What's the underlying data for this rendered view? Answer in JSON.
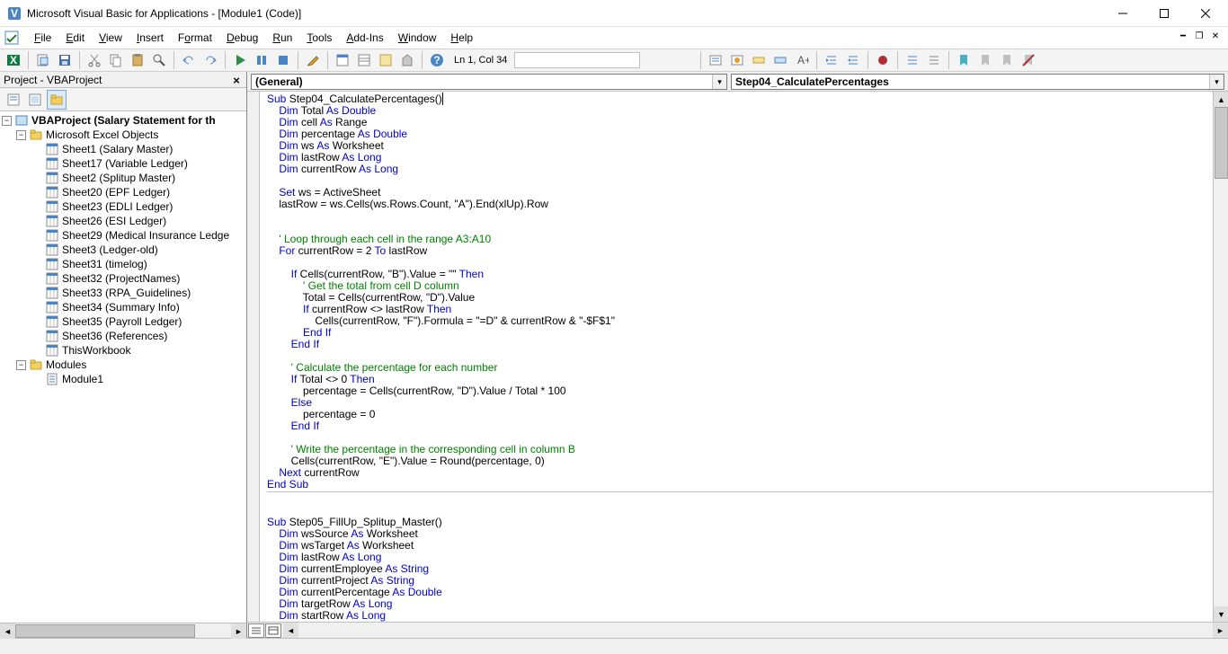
{
  "title": "Microsoft Visual Basic for Applications - [Module1 (Code)]",
  "menus": [
    "File",
    "Edit",
    "View",
    "Insert",
    "Format",
    "Debug",
    "Run",
    "Tools",
    "Add-Ins",
    "Window",
    "Help"
  ],
  "menu_underlines": [
    "F",
    "E",
    "V",
    "I",
    "o",
    "D",
    "R",
    "T",
    "A",
    "W",
    "H"
  ],
  "cursor_pos": "Ln 1, Col 34",
  "project_title": "Project - VBAProject",
  "combo_left": "(General)",
  "combo_right": "Step04_CalculatePercentages",
  "tree": {
    "root": "VBAProject (Salary Statement for th",
    "folder1": "Microsoft Excel Objects",
    "sheets": [
      "Sheet1 (Salary Master)",
      "Sheet17 (Variable Ledger)",
      "Sheet2 (Splitup Master)",
      "Sheet20 (EPF Ledger)",
      "Sheet23 (EDLI Ledger)",
      "Sheet26 (ESI Ledger)",
      "Sheet29 (Medical Insurance Ledge",
      "Sheet3 (Ledger-old)",
      "Sheet31 (timelog)",
      "Sheet32 (ProjectNames)",
      "Sheet33 (RPA_Guidelines)",
      "Sheet34 (Summary Info)",
      "Sheet35 (Payroll Ledger)",
      "Sheet36 (References)",
      "ThisWorkbook"
    ],
    "folder2": "Modules",
    "modules": [
      "Module1"
    ]
  },
  "code_lines": [
    [
      [
        "kw",
        "Sub"
      ],
      [
        "tx",
        " Step04_CalculatePercentages()"
      ],
      [
        "cursor",
        ""
      ]
    ],
    [
      [
        "tx",
        "    "
      ],
      [
        "kw",
        "Dim"
      ],
      [
        "tx",
        " Total "
      ],
      [
        "kw",
        "As Double"
      ]
    ],
    [
      [
        "tx",
        "    "
      ],
      [
        "kw",
        "Dim"
      ],
      [
        "tx",
        " cell "
      ],
      [
        "kw",
        "As"
      ],
      [
        "tx",
        " Range"
      ]
    ],
    [
      [
        "tx",
        "    "
      ],
      [
        "kw",
        "Dim"
      ],
      [
        "tx",
        " percentage "
      ],
      [
        "kw",
        "As Double"
      ]
    ],
    [
      [
        "tx",
        "    "
      ],
      [
        "kw",
        "Dim"
      ],
      [
        "tx",
        " ws "
      ],
      [
        "kw",
        "As"
      ],
      [
        "tx",
        " Worksheet"
      ]
    ],
    [
      [
        "tx",
        "    "
      ],
      [
        "kw",
        "Dim"
      ],
      [
        "tx",
        " lastRow "
      ],
      [
        "kw",
        "As Long"
      ]
    ],
    [
      [
        "tx",
        "    "
      ],
      [
        "kw",
        "Dim"
      ],
      [
        "tx",
        " currentRow "
      ],
      [
        "kw",
        "As Long"
      ]
    ],
    [
      [
        "tx",
        ""
      ]
    ],
    [
      [
        "tx",
        "    "
      ],
      [
        "kw",
        "Set"
      ],
      [
        "tx",
        " ws = ActiveSheet"
      ]
    ],
    [
      [
        "tx",
        "    lastRow = ws.Cells(ws.Rows.Count, \"A\").End(xlUp).Row"
      ]
    ],
    [
      [
        "tx",
        ""
      ]
    ],
    [
      [
        "tx",
        ""
      ]
    ],
    [
      [
        "tx",
        "    "
      ],
      [
        "cm",
        "' Loop through each cell in the range A3:A10"
      ]
    ],
    [
      [
        "tx",
        "    "
      ],
      [
        "kw",
        "For"
      ],
      [
        "tx",
        " currentRow = 2 "
      ],
      [
        "kw",
        "To"
      ],
      [
        "tx",
        " lastRow"
      ]
    ],
    [
      [
        "tx",
        ""
      ]
    ],
    [
      [
        "tx",
        "        "
      ],
      [
        "kw",
        "If"
      ],
      [
        "tx",
        " Cells(currentRow, \"B\").Value = \"\" "
      ],
      [
        "kw",
        "Then"
      ]
    ],
    [
      [
        "tx",
        "            "
      ],
      [
        "cm",
        "' Get the total from cell D column"
      ]
    ],
    [
      [
        "tx",
        "            Total = Cells(currentRow, \"D\").Value"
      ]
    ],
    [
      [
        "tx",
        "            "
      ],
      [
        "kw",
        "If"
      ],
      [
        "tx",
        " currentRow <> lastRow "
      ],
      [
        "kw",
        "Then"
      ]
    ],
    [
      [
        "tx",
        "                Cells(currentRow, \"F\").Formula = \"=D\" & currentRow & \"-$F$1\""
      ]
    ],
    [
      [
        "tx",
        "            "
      ],
      [
        "kw",
        "End If"
      ]
    ],
    [
      [
        "tx",
        "        "
      ],
      [
        "kw",
        "End If"
      ]
    ],
    [
      [
        "tx",
        ""
      ]
    ],
    [
      [
        "tx",
        "        "
      ],
      [
        "cm",
        "' Calculate the percentage for each number"
      ]
    ],
    [
      [
        "tx",
        "        "
      ],
      [
        "kw",
        "If"
      ],
      [
        "tx",
        " Total <> 0 "
      ],
      [
        "kw",
        "Then"
      ]
    ],
    [
      [
        "tx",
        "            percentage = Cells(currentRow, \"D\").Value / Total * 100"
      ]
    ],
    [
      [
        "tx",
        "        "
      ],
      [
        "kw",
        "Else"
      ]
    ],
    [
      [
        "tx",
        "            percentage = 0"
      ]
    ],
    [
      [
        "tx",
        "        "
      ],
      [
        "kw",
        "End If"
      ]
    ],
    [
      [
        "tx",
        ""
      ]
    ],
    [
      [
        "tx",
        "        "
      ],
      [
        "cm",
        "' Write the percentage in the corresponding cell in column B"
      ]
    ],
    [
      [
        "tx",
        "        Cells(currentRow, \"E\").Value = Round(percentage, 0)"
      ]
    ],
    [
      [
        "tx",
        "    "
      ],
      [
        "kw",
        "Next"
      ],
      [
        "tx",
        " currentRow"
      ]
    ],
    [
      [
        "kw",
        "End Sub"
      ]
    ],
    [
      [
        "tx",
        ""
      ]
    ],
    [
      [
        "tx",
        ""
      ]
    ],
    [
      [
        "kw",
        "Sub"
      ],
      [
        "tx",
        " Step05_FillUp_Splitup_Master()"
      ]
    ],
    [
      [
        "tx",
        "    "
      ],
      [
        "kw",
        "Dim"
      ],
      [
        "tx",
        " wsSource "
      ],
      [
        "kw",
        "As"
      ],
      [
        "tx",
        " Worksheet"
      ]
    ],
    [
      [
        "tx",
        "    "
      ],
      [
        "kw",
        "Dim"
      ],
      [
        "tx",
        " wsTarget "
      ],
      [
        "kw",
        "As"
      ],
      [
        "tx",
        " Worksheet"
      ]
    ],
    [
      [
        "tx",
        "    "
      ],
      [
        "kw",
        "Dim"
      ],
      [
        "tx",
        " lastRow "
      ],
      [
        "kw",
        "As Long"
      ]
    ],
    [
      [
        "tx",
        "    "
      ],
      [
        "kw",
        "Dim"
      ],
      [
        "tx",
        " currentEmployee "
      ],
      [
        "kw",
        "As String"
      ]
    ],
    [
      [
        "tx",
        "    "
      ],
      [
        "kw",
        "Dim"
      ],
      [
        "tx",
        " currentProject "
      ],
      [
        "kw",
        "As String"
      ]
    ],
    [
      [
        "tx",
        "    "
      ],
      [
        "kw",
        "Dim"
      ],
      [
        "tx",
        " currentPercentage "
      ],
      [
        "kw",
        "As Double"
      ]
    ],
    [
      [
        "tx",
        "    "
      ],
      [
        "kw",
        "Dim"
      ],
      [
        "tx",
        " targetRow "
      ],
      [
        "kw",
        "As Long"
      ]
    ],
    [
      [
        "tx",
        "    "
      ],
      [
        "kw",
        "Dim"
      ],
      [
        "tx",
        " startRow "
      ],
      [
        "kw",
        "As Long"
      ]
    ]
  ]
}
